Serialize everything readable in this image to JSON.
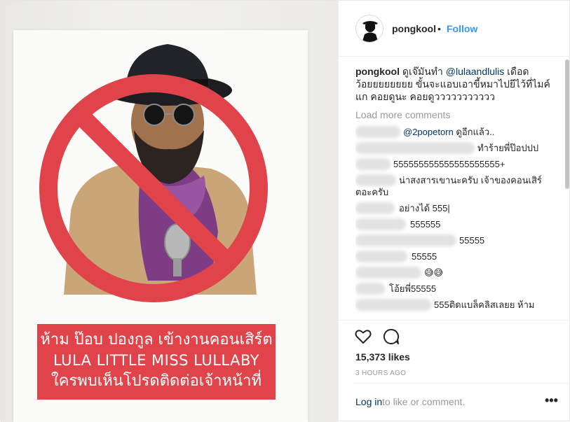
{
  "header": {
    "username": "pongkool",
    "separator": "•",
    "follow_label": "Follow"
  },
  "caption": {
    "username": "pongkool",
    "text_before": "ดูเจ๊มันทำ",
    "mention": "@lulaandlulis",
    "text_after": "เดือดว้อยยยยยยยย ขั้นจะแอบเอาขี้หมาไปยีไว้ที่ไมค์แก คอยดูนะ คอยดูววววววววววว"
  },
  "load_more_label": "Load more comments",
  "comments": [
    {
      "mention": "@2popetorn",
      "text": "ดูอีกแล้ว.."
    },
    {
      "text": "ทำร้ายพี่ป๊อปปป"
    },
    {
      "text": "555555555555555555555+"
    },
    {
      "text": "น่าสงสารเขานะครับ เจ้าของคอนเสิร์ตอะครับ"
    },
    {
      "text": "อย่างได้ 555|"
    },
    {
      "text": "555555"
    },
    {
      "text": "55555"
    },
    {
      "text": "55555"
    },
    {
      "text": "😅😅"
    },
    {
      "text": "โอ้ยพี่55555"
    },
    {
      "text": "555ติดแบล็คลิสเลยย ห้าม"
    }
  ],
  "actions": {
    "likes": "15,373 likes",
    "time": "3 HOURS AGO"
  },
  "add_comment": {
    "login_label": "Log in",
    "rest_label": "to like or comment.",
    "more_icon": "•••"
  },
  "photo": {
    "banner_line1": "ห้าม ป๊อบ ปองกูล เข้างานคอนเสิร์ต",
    "banner_line2": "LULA LITTLE MISS LULLABY",
    "banner_line3": "ใครพบเห็นโปรดติดต่อเจ้าหน้าที่",
    "banner_color": "#e0444a",
    "prohibition_color": "#e0444a"
  },
  "colors": {
    "follow": "#3897f0",
    "text": "#262626",
    "muted": "#999999",
    "link": "#003569"
  }
}
